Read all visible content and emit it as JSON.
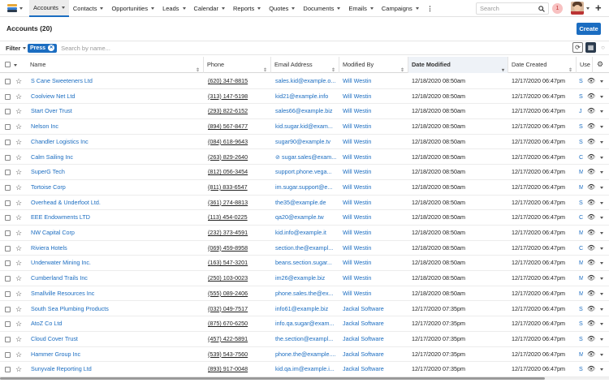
{
  "nav": {
    "items": [
      {
        "label": "Accounts",
        "active": true
      },
      {
        "label": "Contacts"
      },
      {
        "label": "Opportunities"
      },
      {
        "label": "Leads"
      },
      {
        "label": "Calendar"
      },
      {
        "label": "Reports"
      },
      {
        "label": "Quotes"
      },
      {
        "label": "Documents"
      },
      {
        "label": "Emails"
      },
      {
        "label": "Campaigns"
      }
    ],
    "more": "⋮",
    "search_placeholder": "Search",
    "notifications": "1",
    "plus": "+"
  },
  "page": {
    "title": "Accounts (20)",
    "create_label": "Create"
  },
  "filter": {
    "label": "Filter",
    "pill": "Press",
    "search_placeholder": "Search by name..."
  },
  "columns": {
    "name": "Name",
    "phone": "Phone",
    "email": "Email Address",
    "modified_by": "Modified By",
    "date_modified": "Date Modified",
    "date_created": "Date Created",
    "user": "Use"
  },
  "colors": {
    "accent": "#1b6dc1",
    "link": "#1b6dc1"
  },
  "rows": [
    {
      "name": "S Cane Sweeteners Ltd",
      "phone": "(620) 347-8815",
      "email": "sales.kid@example.o...",
      "modified_by": "Will Westin",
      "date_modified": "12/18/2020 08:50am",
      "date_created": "12/17/2020 06:47pm",
      "user": "S"
    },
    {
      "name": "Coolview Net Ltd",
      "phone": "(313) 147-5198",
      "email": "kid21@example.info",
      "modified_by": "Will Westin",
      "date_modified": "12/18/2020 08:50am",
      "date_created": "12/17/2020 06:47pm",
      "user": "S"
    },
    {
      "name": "Start Over Trust",
      "phone": "(293) 822-6152",
      "email": "sales66@example.biz",
      "modified_by": "Will Westin",
      "date_modified": "12/18/2020 08:50am",
      "date_created": "12/17/2020 06:47pm",
      "user": "J"
    },
    {
      "name": "Nelson Inc",
      "phone": "(894) 567-8477",
      "email": "kid.sugar.kid@exam...",
      "modified_by": "Will Westin",
      "date_modified": "12/18/2020 08:50am",
      "date_created": "12/17/2020 06:47pm",
      "user": "S"
    },
    {
      "name": "Chandler Logistics Inc",
      "phone": "(084) 618-9643",
      "email": "sugar90@example.tv",
      "modified_by": "Will Westin",
      "date_modified": "12/18/2020 08:50am",
      "date_created": "12/17/2020 06:47pm",
      "user": "S"
    },
    {
      "name": "Calm Sailing Inc",
      "phone": "(263) 829-2640",
      "email": "⊘ sugar.sales@exam...",
      "modified_by": "Will Westin",
      "date_modified": "12/18/2020 08:50am",
      "date_created": "12/17/2020 06:47pm",
      "user": "C"
    },
    {
      "name": "SuperG Tech",
      "phone": "(812) 056-3454",
      "email": "support.phone.vega...",
      "modified_by": "Will Westin",
      "date_modified": "12/18/2020 08:50am",
      "date_created": "12/17/2020 06:47pm",
      "user": "M"
    },
    {
      "name": "Tortoise Corp",
      "phone": "(811) 833-6547",
      "email": "im.sugar.support@e...",
      "modified_by": "Will Westin",
      "date_modified": "12/18/2020 08:50am",
      "date_created": "12/17/2020 06:47pm",
      "user": "M"
    },
    {
      "name": "Overhead & Underfoot Ltd.",
      "phone": "(361) 274-8813",
      "email": "the35@example.de",
      "modified_by": "Will Westin",
      "date_modified": "12/18/2020 08:50am",
      "date_created": "12/17/2020 06:47pm",
      "user": "S"
    },
    {
      "name": "EEE Endowments LTD",
      "phone": "(113) 454-0225",
      "email": "qa20@example.tw",
      "modified_by": "Will Westin",
      "date_modified": "12/18/2020 08:50am",
      "date_created": "12/17/2020 06:47pm",
      "user": "C"
    },
    {
      "name": "NW Capital Corp",
      "phone": "(232) 373-4591",
      "email": "kid.info@example.it",
      "modified_by": "Will Westin",
      "date_modified": "12/18/2020 08:50am",
      "date_created": "12/17/2020 06:47pm",
      "user": "M"
    },
    {
      "name": "Riviera Hotels",
      "phone": "(069) 459-8958",
      "email": "section.the@exampl...",
      "modified_by": "Will Westin",
      "date_modified": "12/18/2020 08:50am",
      "date_created": "12/17/2020 06:47pm",
      "user": "C"
    },
    {
      "name": "Underwater Mining Inc.",
      "phone": "(163) 547-3201",
      "email": "beans.section.sugar...",
      "modified_by": "Will Westin",
      "date_modified": "12/18/2020 08:50am",
      "date_created": "12/17/2020 06:47pm",
      "user": "M"
    },
    {
      "name": "Cumberland Trails Inc",
      "phone": "(250) 103-0023",
      "email": "im26@example.biz",
      "modified_by": "Will Westin",
      "date_modified": "12/18/2020 08:50am",
      "date_created": "12/17/2020 06:47pm",
      "user": "M"
    },
    {
      "name": "Smallville Resources Inc",
      "phone": "(555) 089-2406",
      "email": "phone.sales.the@ex...",
      "modified_by": "Will Westin",
      "date_modified": "12/18/2020 08:50am",
      "date_created": "12/17/2020 06:47pm",
      "user": "M"
    },
    {
      "name": "South Sea Plumbing Products",
      "phone": "(032) 049-7517",
      "email": "info61@example.biz",
      "modified_by": "Jackal Software",
      "date_modified": "12/17/2020 07:35pm",
      "date_created": "12/17/2020 06:47pm",
      "user": "S"
    },
    {
      "name": "AtoZ Co Ltd",
      "phone": "(875) 670-6250",
      "email": "info.qa.sugar@exam...",
      "modified_by": "Jackal Software",
      "date_modified": "12/17/2020 07:35pm",
      "date_created": "12/17/2020 06:47pm",
      "user": "S"
    },
    {
      "name": "Cloud Cover Trust",
      "phone": "(457) 422-5891",
      "email": "the.section@exampl...",
      "modified_by": "Jackal Software",
      "date_modified": "12/17/2020 07:35pm",
      "date_created": "12/17/2020 06:47pm",
      "user": "S"
    },
    {
      "name": "Hammer Group Inc",
      "phone": "(539) 543-7560",
      "email": "phone.the@example....",
      "modified_by": "Jackal Software",
      "date_modified": "12/17/2020 07:35pm",
      "date_created": "12/17/2020 06:47pm",
      "user": "M"
    },
    {
      "name": "Sunyvale Reporting Ltd",
      "phone": "(893) 917-0048",
      "email": "kid.qa.im@example.i...",
      "modified_by": "Jackal Software",
      "date_modified": "12/17/2020 07:35pm",
      "date_created": "12/17/2020 06:47pm",
      "user": "S"
    }
  ]
}
